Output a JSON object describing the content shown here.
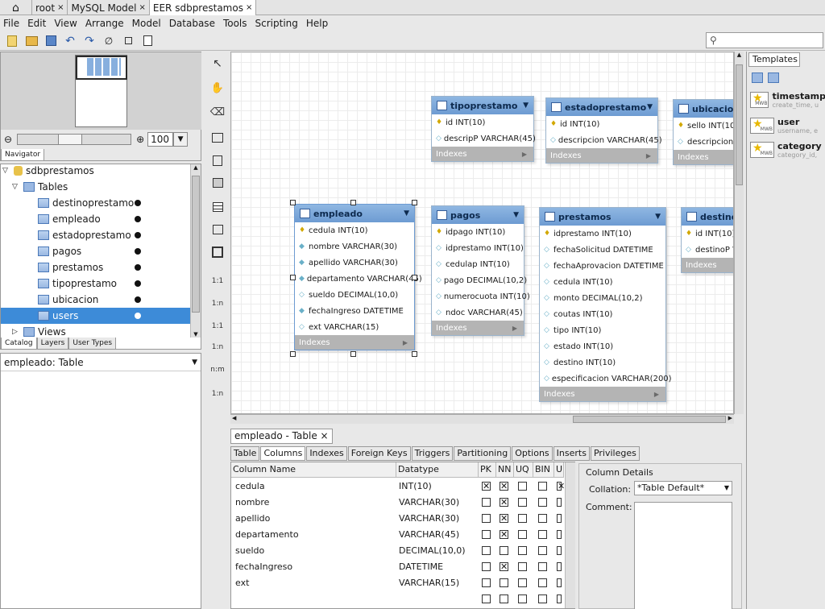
{
  "window": {
    "tabs": [
      {
        "label": "root",
        "close": "×"
      },
      {
        "label": "MySQL Model",
        "close": "×"
      },
      {
        "label": "EER sdbprestamos",
        "close": "×"
      }
    ]
  },
  "menu": [
    "File",
    "Edit",
    "View",
    "Arrange",
    "Model",
    "Database",
    "Tools",
    "Scripting",
    "Help"
  ],
  "navigator": {
    "zoom": "100",
    "tab": "Navigator"
  },
  "catalog": {
    "schema": "sdbprestamos",
    "tables_label": "Tables",
    "tables": [
      "destinoprestamo",
      "empleado",
      "estadoprestamo",
      "pagos",
      "prestamos",
      "tipoprestamo",
      "ubicacion",
      "users"
    ],
    "views_label": "Views",
    "tabs": [
      "Catalog",
      "Layers",
      "User Types"
    ]
  },
  "properties": {
    "title": "empleado: Table"
  },
  "templates": {
    "tab": "Templates",
    "items": [
      {
        "name": "timestamp",
        "sub": "create_time, u"
      },
      {
        "name": "user",
        "sub": "username, e"
      },
      {
        "name": "category",
        "sub": "category_id,"
      }
    ],
    "badge": "MWB"
  },
  "tools": [
    "1:1",
    "1:n",
    "1:1",
    "1:n",
    "n:m",
    "1:n"
  ],
  "entities": {
    "indexes_label": "Indexes",
    "tipoprestamo": {
      "title": "tipoprestamo",
      "cols": [
        "id INT(10)",
        "descripP VARCHAR(45)"
      ]
    },
    "estadoprestamo": {
      "title": "estadoprestamo",
      "cols": [
        "id INT(10)",
        "descripcion VARCHAR(45)"
      ]
    },
    "ubicacion": {
      "title": "ubicacion",
      "cols": [
        "sello INT(10)",
        "descripcion V"
      ]
    },
    "empleado": {
      "title": "empleado",
      "cols": [
        "cedula INT(10)",
        "nombre VARCHAR(30)",
        "apellido VARCHAR(30)",
        "departamento VARCHAR(45)",
        "sueldo DECIMAL(10,0)",
        "fechaIngreso DATETIME",
        "ext VARCHAR(15)"
      ]
    },
    "pagos": {
      "title": "pagos",
      "cols": [
        "idpago INT(10)",
        "idprestamo INT(10)",
        "cedulap INT(10)",
        "pago DECIMAL(10,2)",
        "numerocuota INT(10)",
        "ndoc VARCHAR(45)"
      ]
    },
    "prestamos": {
      "title": "prestamos",
      "cols": [
        "idprestamo INT(10)",
        "fechaSolicitud DATETIME",
        "fechaAprovacion DATETIME",
        "cedula INT(10)",
        "monto DECIMAL(10,2)",
        "coutas INT(10)",
        "tipo INT(10)",
        "estado INT(10)",
        "destino INT(10)",
        "especificacion VARCHAR(200)"
      ]
    },
    "destino": {
      "title": "destino",
      "cols": [
        "id INT(10)",
        "destinoP V"
      ]
    }
  },
  "editor": {
    "tab": "empleado - Table",
    "tab_close": "×",
    "subtabs": [
      "Table",
      "Columns",
      "Indexes",
      "Foreign Keys",
      "Triggers",
      "Partitioning",
      "Options",
      "Inserts",
      "Privileges"
    ],
    "headers": [
      "Column Name",
      "Datatype",
      "PK",
      "NN",
      "UQ",
      "BIN",
      "U"
    ],
    "rows": [
      {
        "name": "cedula",
        "type": "INT(10)",
        "pk": true,
        "nn": true
      },
      {
        "name": "nombre",
        "type": "VARCHAR(30)",
        "pk": false,
        "nn": true
      },
      {
        "name": "apellido",
        "type": "VARCHAR(30)",
        "pk": false,
        "nn": true
      },
      {
        "name": "departamento",
        "type": "VARCHAR(45)",
        "pk": false,
        "nn": true
      },
      {
        "name": "sueldo",
        "type": "DECIMAL(10,0)",
        "pk": false,
        "nn": false
      },
      {
        "name": "fechaIngreso",
        "type": "DATETIME",
        "pk": false,
        "nn": true
      },
      {
        "name": "ext",
        "type": "VARCHAR(15)",
        "pk": false,
        "nn": false
      }
    ],
    "details": {
      "title": "Column Details",
      "collation_label": "Collation:",
      "collation_value": "*Table Default*",
      "comment_label": "Comment:"
    }
  },
  "colors": {
    "selection": "#3d8bd8",
    "entity_header": "#8fb7e2"
  }
}
